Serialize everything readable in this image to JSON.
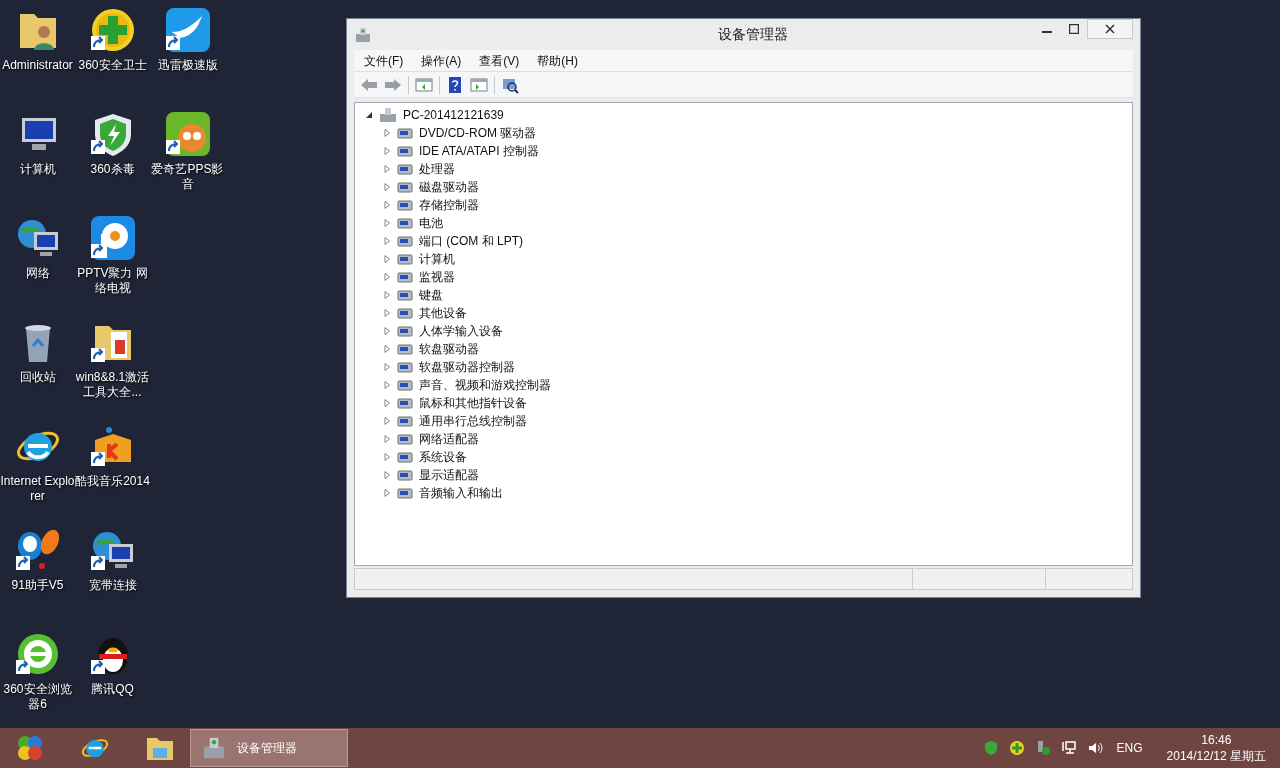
{
  "desktop_icons": [
    {
      "label": "Administrator",
      "kind": "user-folder",
      "shortcut": false
    },
    {
      "label": "计算机",
      "kind": "computer",
      "shortcut": false
    },
    {
      "label": "网络",
      "kind": "network",
      "shortcut": false
    },
    {
      "label": "回收站",
      "kind": "recycle-bin",
      "shortcut": false
    },
    {
      "label": "Internet Explorer",
      "kind": "ie",
      "shortcut": false
    },
    {
      "label": "91助手V5",
      "kind": "balloon",
      "shortcut": true
    },
    {
      "label": "360安全浏览器6",
      "kind": "green-e",
      "shortcut": true
    },
    {
      "label": "360安全卫士",
      "kind": "plus",
      "shortcut": true
    },
    {
      "label": "360杀毒",
      "kind": "shield",
      "shortcut": true
    },
    {
      "label": "PPTV聚力 网络电视",
      "kind": "p-circle",
      "shortcut": true
    },
    {
      "label": "win8&8.1激活工具大全...",
      "kind": "folder",
      "shortcut": true
    },
    {
      "label": "酷我音乐2014",
      "kind": "music-box",
      "shortcut": true
    },
    {
      "label": "宽带连接",
      "kind": "network",
      "shortcut": true
    },
    {
      "label": "腾讯QQ",
      "kind": "penguin",
      "shortcut": true
    },
    {
      "label": "迅雷极速版",
      "kind": "bird",
      "shortcut": true
    },
    {
      "label": "爱奇艺PPS影音",
      "kind": "cartoon",
      "shortcut": true
    }
  ],
  "window": {
    "title": "设备管理器",
    "menu": [
      "文件(F)",
      "操作(A)",
      "查看(V)",
      "帮助(H)"
    ],
    "tree": {
      "label": "PC-201412121639",
      "expanded": true,
      "children": [
        {
          "label": "DVD/CD-ROM 驱动器",
          "expanded": false
        },
        {
          "label": "IDE ATA/ATAPI 控制器",
          "expanded": false
        },
        {
          "label": "处理器",
          "expanded": false
        },
        {
          "label": "磁盘驱动器",
          "expanded": false
        },
        {
          "label": "存储控制器",
          "expanded": false
        },
        {
          "label": "电池",
          "expanded": false
        },
        {
          "label": "端口 (COM 和 LPT)",
          "expanded": false
        },
        {
          "label": "计算机",
          "expanded": false
        },
        {
          "label": "监视器",
          "expanded": false
        },
        {
          "label": "键盘",
          "expanded": false
        },
        {
          "label": "其他设备",
          "expanded": false
        },
        {
          "label": "人体学输入设备",
          "expanded": false
        },
        {
          "label": "软盘驱动器",
          "expanded": false
        },
        {
          "label": "软盘驱动器控制器",
          "expanded": false
        },
        {
          "label": "声音、视频和游戏控制器",
          "expanded": false
        },
        {
          "label": "鼠标和其他指针设备",
          "expanded": false
        },
        {
          "label": "通用串行总线控制器",
          "expanded": false
        },
        {
          "label": "网络适配器",
          "expanded": false
        },
        {
          "label": "系统设备",
          "expanded": false
        },
        {
          "label": "显示适配器",
          "expanded": false
        },
        {
          "label": "音频输入和输出",
          "expanded": false
        }
      ]
    }
  },
  "taskbar": {
    "tasks": [
      {
        "label": "设备管理器",
        "selected": true
      }
    ],
    "language": "ENG",
    "time": "16:46",
    "date": "2014/12/12 星期五"
  }
}
